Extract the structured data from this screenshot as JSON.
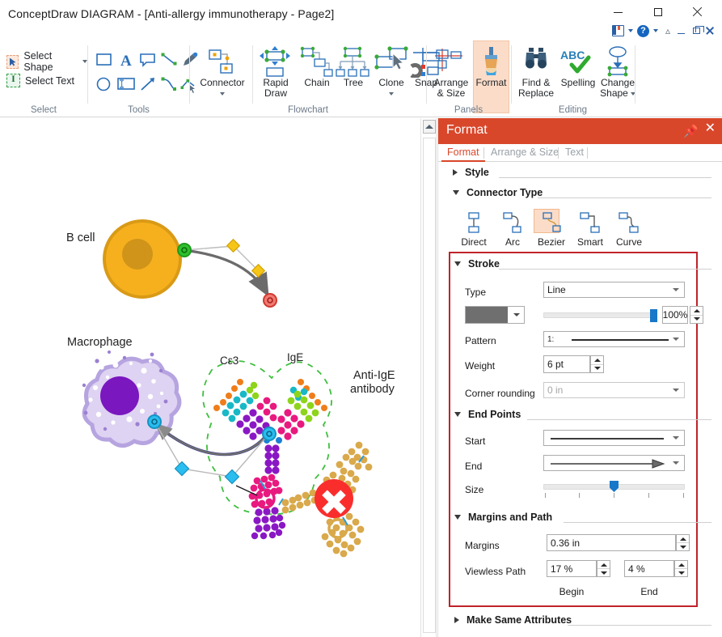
{
  "window": {
    "title": "ConceptDraw DIAGRAM - [Anti-allergy immunotherapy - Page2]",
    "minimize": "minimize-icon",
    "maximize": "maximize-icon",
    "close": "close-icon",
    "doc_bar": {
      "ribbon_display_options": "ribbon-options-icon",
      "help": "help-icon",
      "collapse_ribbon": "collapse-ribbon-icon",
      "doc_minimize": "doc-minimize-icon",
      "doc_restore": "doc-restore-icon",
      "doc_close": "doc-close-icon"
    }
  },
  "ribbon": {
    "groups": [
      {
        "name": "Select",
        "label": "Select"
      },
      {
        "name": "Tools",
        "label": "Tools"
      },
      {
        "name": "Flowchart",
        "label": "Flowchart"
      },
      {
        "name": "Panels",
        "label": "Panels"
      },
      {
        "name": "Editing",
        "label": "Editing"
      }
    ],
    "select": {
      "select_shape": "Select Shape",
      "select_text": "Select Text"
    },
    "tools": {
      "rectangle": "rectangle-tool-icon",
      "text": "text-tool-icon",
      "callout": "callout-tool-icon",
      "line": "line-tool-icon",
      "pen": "pen-tool-icon",
      "ellipse": "ellipse-tool-icon",
      "text_block": "text-block-tool-icon",
      "arrow": "arrow-tool-icon",
      "curve": "curve-tool-icon",
      "edit_points": "edit-points-tool-icon"
    },
    "flowchart": {
      "connector": "Connector",
      "rapid_draw": "Rapid\nDraw",
      "rapid_draw_l1": "Rapid",
      "rapid_draw_l2": "Draw",
      "chain": "Chain",
      "tree": "Tree",
      "clone": "Clone",
      "snap": "Snap"
    },
    "panels": {
      "arrange_size_l1": "Arrange",
      "arrange_size_l2": "& Size",
      "format": "Format"
    },
    "editing": {
      "find_replace_l1": "Find &",
      "find_replace_l2": "Replace",
      "spelling": "Spelling",
      "change_shape_l1": "Change",
      "change_shape_l2": "Shape"
    }
  },
  "canvas": {
    "labels": {
      "b_cell": "B cell",
      "macrophage": "Macrophage",
      "ce3": "Cε3",
      "ige": "IgE",
      "anti_ige_l1": "Anti-IgE",
      "anti_ige_l2": "antibody"
    },
    "block_marker": "blocked-icon"
  },
  "panel": {
    "title": "Format",
    "pin": "pin-icon",
    "close": "close-icon",
    "tabs": [
      {
        "label": "Format",
        "active": true
      },
      {
        "label": "Arrange & Size",
        "active": false
      },
      {
        "label": "Text",
        "active": false
      }
    ],
    "sections": {
      "style": {
        "label": "Style",
        "expanded": false
      },
      "connector_type": {
        "label": "Connector Type",
        "expanded": true
      },
      "stroke": {
        "label": "Stroke",
        "expanded": true
      },
      "end_points": {
        "label": "End Points",
        "expanded": true
      },
      "margins_and_path": {
        "label": "Margins and Path",
        "expanded": true
      },
      "make_same_attributes": {
        "label": "Make Same Attributes",
        "expanded": false
      }
    },
    "connector_types": [
      {
        "label": "Direct",
        "selected": false
      },
      {
        "label": "Arc",
        "selected": false
      },
      {
        "label": "Bezier",
        "selected": true
      },
      {
        "label": "Smart",
        "selected": false
      },
      {
        "label": "Curve",
        "selected": false
      }
    ],
    "stroke": {
      "type_label": "Type",
      "type_value": "Line",
      "color_swatch": "#6f6f6f",
      "opacity_value": "100%",
      "pattern_label": "Pattern",
      "pattern_value": "1:",
      "weight_label": "Weight",
      "weight_value": "6 pt",
      "corner_rounding_label": "Corner rounding",
      "corner_rounding_value": "0 in"
    },
    "end_points": {
      "start_label": "Start",
      "start_value": "",
      "end_label": "End",
      "end_value": "",
      "size_label": "Size"
    },
    "margins_path": {
      "margins_label": "Margins",
      "margins_value": "0.36 in",
      "viewless_path_label": "Viewless Path",
      "begin_value": "17 %",
      "end_value": "4 %",
      "begin_caption": "Begin",
      "end_caption": "End"
    },
    "accent_color": "#d9472b",
    "highlight_color": "#c0232a"
  }
}
